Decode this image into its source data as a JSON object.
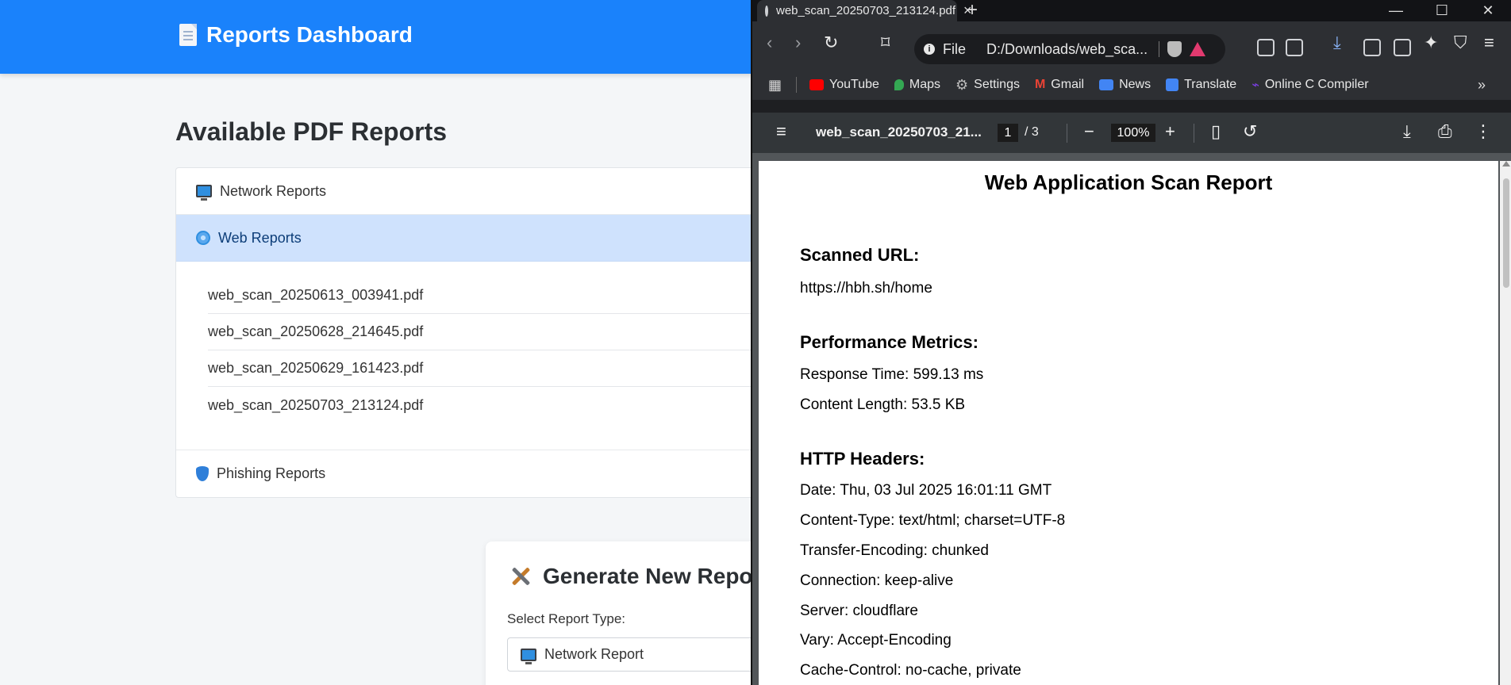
{
  "app": {
    "title": "Reports Dashboard",
    "section_title": "Available PDF Reports",
    "accordion": [
      {
        "label": "Network Reports",
        "icon": "monitor-icon"
      },
      {
        "label": "Web Reports",
        "icon": "globe-icon",
        "expanded": true,
        "files": [
          "web_scan_20250613_003941.pdf",
          "web_scan_20250628_214645.pdf",
          "web_scan_20250629_161423.pdf",
          "web_scan_20250703_213124.pdf"
        ]
      },
      {
        "label": "Phishing Reports",
        "icon": "shield-icon"
      }
    ],
    "generate": {
      "title": "Generate New Report",
      "select_label": "Select Report Type:",
      "selected": "Network Report"
    }
  },
  "browser": {
    "tab_title": "web_scan_20250703_213124.pdf",
    "url_scheme": "File",
    "url": "D:/Downloads/web_sca...",
    "bookmarks": [
      {
        "label": "YouTube",
        "color": "#ff0000"
      },
      {
        "label": "Maps",
        "color": "#34a853"
      },
      {
        "label": "Settings",
        "color": "#bbbbbb"
      },
      {
        "label": "Gmail",
        "color": "#ea4335"
      },
      {
        "label": "News",
        "color": "#4285f4"
      },
      {
        "label": "Translate",
        "color": "#4285f4"
      },
      {
        "label": "Online C Compiler",
        "color": "#7b3fe4"
      }
    ],
    "pdf": {
      "filename": "web_scan_20250703_21...",
      "page_current": "1",
      "page_total": "/ 3",
      "zoom": "100%"
    }
  },
  "report": {
    "title": "Web Application Scan Report",
    "scanned_url_heading": "Scanned URL:",
    "scanned_url": "https://hbh.sh/home",
    "perf_heading": "Performance Metrics:",
    "response_time": "Response Time: 599.13 ms",
    "content_length": "Content Length: 53.5 KB",
    "headers_heading": "HTTP Headers:",
    "headers": [
      "Date: Thu, 03 Jul 2025 16:01:11 GMT",
      "Content-Type: text/html; charset=UTF-8",
      "Transfer-Encoding: chunked",
      "Connection: keep-alive",
      "Server: cloudflare",
      "Vary: Accept-Encoding",
      "Cache-Control: no-cache, private"
    ]
  }
}
